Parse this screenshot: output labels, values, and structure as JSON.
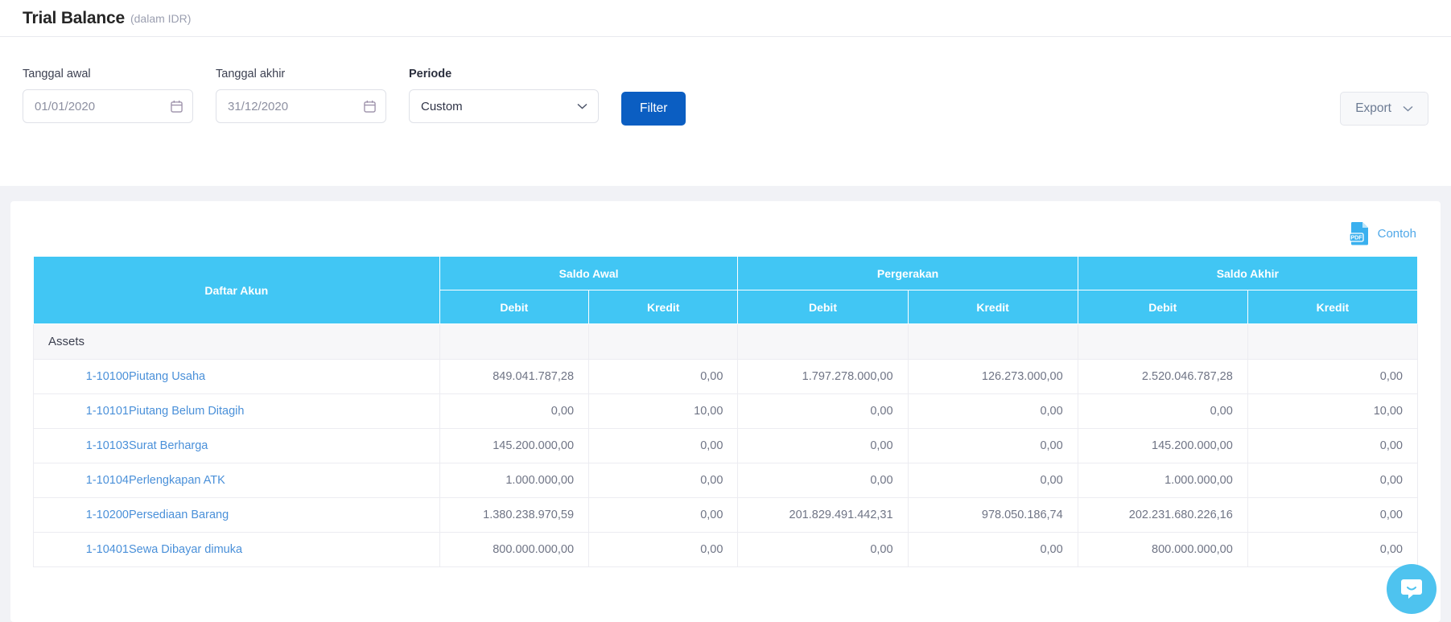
{
  "header": {
    "title": "Trial Balance",
    "subtitle": "(dalam IDR)"
  },
  "filters": {
    "start_date": {
      "label": "Tanggal awal",
      "value": "01/01/2020",
      "icon": "calendar-icon"
    },
    "end_date": {
      "label": "Tanggal akhir",
      "value": "31/12/2020",
      "icon": "calendar-icon"
    },
    "period": {
      "label": "Periode",
      "value": "Custom",
      "icon": "chevron-down-icon"
    },
    "filter_button": "Filter",
    "export_button": {
      "label": "Export",
      "icon": "chevron-down-icon"
    }
  },
  "card": {
    "sample_link": {
      "label": "Contoh",
      "icon": "pdf-file-icon"
    }
  },
  "table": {
    "col_account": "Daftar Akun",
    "groups": [
      {
        "label": "Saldo Awal",
        "sub": [
          "Debit",
          "Kredit"
        ]
      },
      {
        "label": "Pergerakan",
        "sub": [
          "Debit",
          "Kredit"
        ]
      },
      {
        "label": "Saldo Akhir",
        "sub": [
          "Debit",
          "Kredit"
        ]
      }
    ],
    "rows": [
      {
        "type": "group",
        "label": "Assets"
      },
      {
        "type": "account",
        "code": "1-10100",
        "name": "Piutang Usaha",
        "values": [
          "849.041.787,28",
          "0,00",
          "1.797.278.000,00",
          "126.273.000,00",
          "2.520.046.787,28",
          "0,00"
        ]
      },
      {
        "type": "account",
        "code": "1-10101",
        "name": "Piutang Belum Ditagih",
        "values": [
          "0,00",
          "10,00",
          "0,00",
          "0,00",
          "0,00",
          "10,00"
        ]
      },
      {
        "type": "account",
        "code": "1-10103",
        "name": "Surat Berharga",
        "values": [
          "145.200.000,00",
          "0,00",
          "0,00",
          "0,00",
          "145.200.000,00",
          "0,00"
        ]
      },
      {
        "type": "account",
        "code": "1-10104",
        "name": "Perlengkapan ATK",
        "values": [
          "1.000.000,00",
          "0,00",
          "0,00",
          "0,00",
          "1.000.000,00",
          "0,00"
        ]
      },
      {
        "type": "account",
        "code": "1-10200",
        "name": "Persediaan Barang",
        "values": [
          "1.380.238.970,59",
          "0,00",
          "201.829.491.442,31",
          "978.050.186,74",
          "202.231.680.226,16",
          "0,00"
        ]
      },
      {
        "type": "account",
        "code": "1-10401",
        "name": "Sewa Dibayar dimuka",
        "values": [
          "800.000.000,00",
          "0,00",
          "0,00",
          "0,00",
          "800.000.000,00",
          "0,00"
        ]
      }
    ]
  },
  "chat": {
    "icon": "chat-bubble-icon"
  },
  "colors": {
    "table_header": "#41c6f4",
    "primary_button": "#0b5ec2",
    "link": "#4a90d9",
    "accent_light": "#4fa8e8",
    "page_bg": "#f1f2f6"
  }
}
